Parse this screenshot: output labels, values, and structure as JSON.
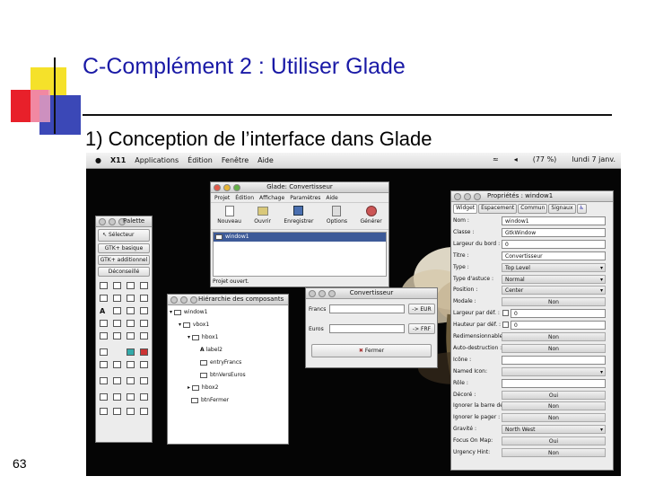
{
  "slide": {
    "title": "C-Complément 2 : Utiliser Glade",
    "subtitle": "1) Conception de l’interface dans Glade",
    "number": "63"
  },
  "menubar": {
    "items": [
      "X11",
      "Applications",
      "Édition",
      "Fenêtre",
      "Aide"
    ],
    "battery": "(77 %)",
    "date": "lundi 7 janv."
  },
  "glade_window": {
    "title": "Glade: Convertisseur",
    "menu": [
      "Projet",
      "Édition",
      "Affichage",
      "Paramètres",
      "Aide"
    ],
    "toolbar": [
      "Nouveau",
      "Ouvrir",
      "Enregistrer",
      "Options",
      "Générer"
    ],
    "list_item": "window1",
    "status": "Projet ouvert."
  },
  "palette": {
    "title": "Palette",
    "selector": "Sélecteur",
    "tabs": [
      "GTK+ basique",
      "GTK+ additionnel",
      "Déconseillé"
    ]
  },
  "hierarchy": {
    "title": "Hiérarchie des composants",
    "items": [
      "window1",
      "vbox1",
      "hbox1",
      "label2",
      "entryFrancs",
      "btnVersEuros",
      "hbox2",
      "btnFermer"
    ]
  },
  "converter": {
    "title": "Convertisseur",
    "francs_label": "Francs",
    "euros_label": "Euros",
    "to_eur": "-> EUR",
    "to_frf": "-> FRF",
    "close": "Fermer"
  },
  "properties": {
    "title": "Propriétés : window1",
    "tabs": [
      "Widget",
      "Espacement",
      "Commun",
      "Signaux"
    ],
    "rows": [
      {
        "label": "Nom :",
        "value": "window1",
        "kind": "field"
      },
      {
        "label": "Classe :",
        "value": "GtkWindow",
        "kind": "field"
      },
      {
        "label": "Largeur du bord :",
        "value": "0",
        "kind": "spin"
      },
      {
        "label": "Titre :",
        "value": "Convertisseur",
        "kind": "field"
      },
      {
        "label": "Type :",
        "value": "Top Level",
        "kind": "combo"
      },
      {
        "label": "Type d'astuce :",
        "value": "Normal",
        "kind": "combo"
      },
      {
        "label": "Position :",
        "value": "Center",
        "kind": "combo"
      },
      {
        "label": "Modale :",
        "value": "Non",
        "kind": "toggle"
      },
      {
        "label": "Largeur par déf. :",
        "value": "0",
        "kind": "check"
      },
      {
        "label": "Hauteur par déf. :",
        "value": "0",
        "kind": "check"
      },
      {
        "label": "Redimensionnable",
        "value": "Non",
        "kind": "toggle"
      },
      {
        "label": "Auto-destruction :",
        "value": "Non",
        "kind": "toggle"
      },
      {
        "label": "Icône :",
        "value": "",
        "kind": "field"
      },
      {
        "label": "Named Icon:",
        "value": "",
        "kind": "combo"
      },
      {
        "label": "Rôle :",
        "value": "",
        "kind": "field"
      },
      {
        "label": "Décoré :",
        "value": "Oui",
        "kind": "toggle"
      },
      {
        "label": "Ignorer la barre de",
        "value": "Non",
        "kind": "toggle"
      },
      {
        "label": "Ignorer le pager :",
        "value": "Non",
        "kind": "toggle"
      },
      {
        "label": "Gravité :",
        "value": "North West",
        "kind": "combo"
      },
      {
        "label": "Focus On Map:",
        "value": "Oui",
        "kind": "toggle"
      },
      {
        "label": "Urgency Hint:",
        "value": "Non",
        "kind": "toggle"
      }
    ]
  }
}
